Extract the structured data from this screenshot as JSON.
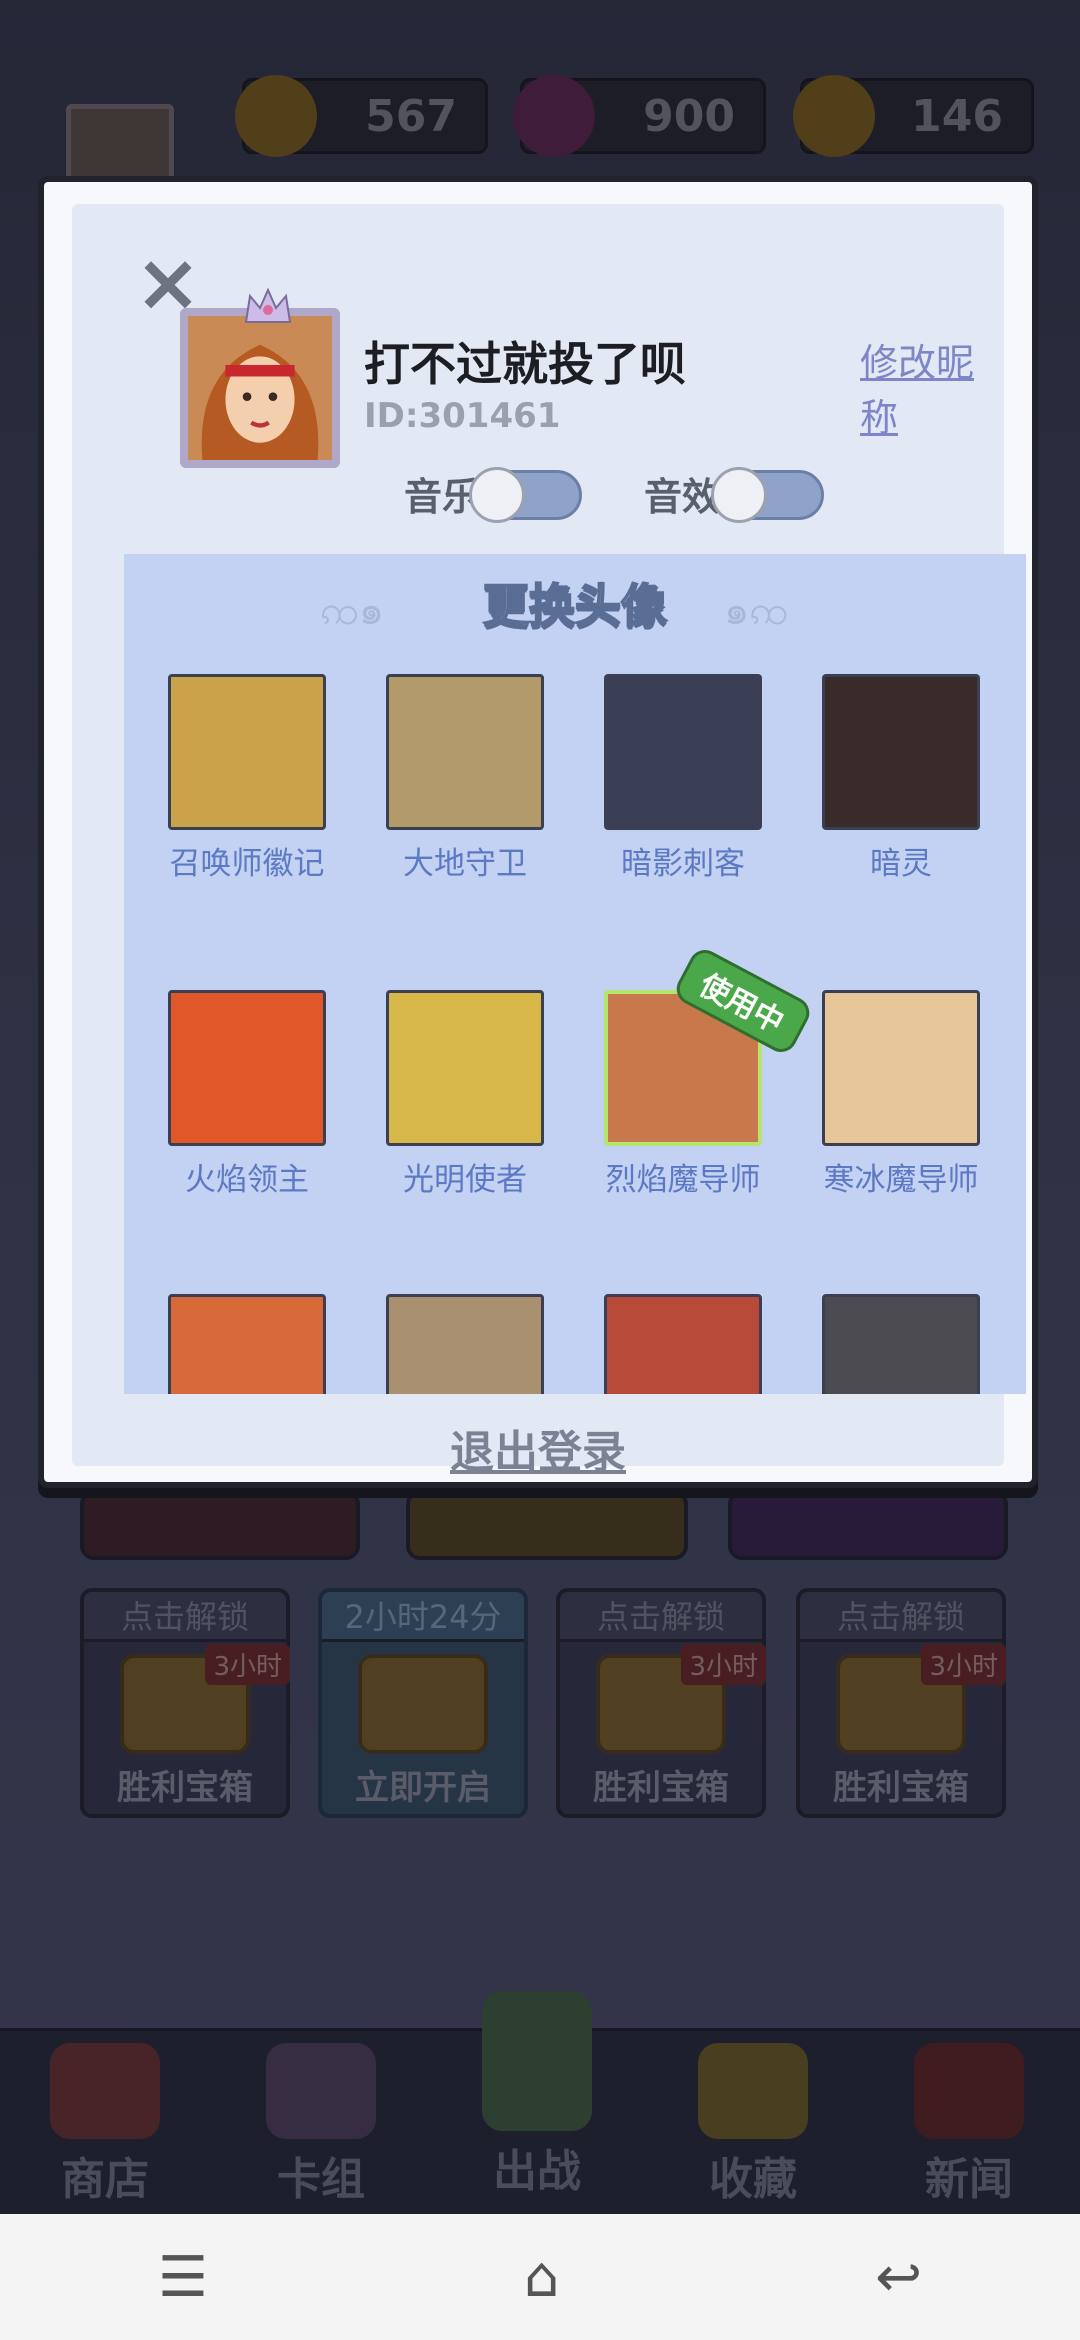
{
  "hud": {
    "gold": "567",
    "gems": "900",
    "stars": "146"
  },
  "profile": {
    "nickname": "打不过就投了呗",
    "id": "ID:301461",
    "rename_label": "修改昵称",
    "music_label": "音乐",
    "sfx_label": "音效",
    "music_on": false,
    "sfx_on": false
  },
  "avatar_panel": {
    "title": "更换头像",
    "in_use_badge": "使用中",
    "avatars": [
      {
        "name": "召唤师徽记",
        "color": "#c9a24a"
      },
      {
        "name": "大地守卫",
        "color": "#b29a6a"
      },
      {
        "name": "暗影刺客",
        "color": "#3b3f55"
      },
      {
        "name": "暗灵",
        "color": "#3a2b2b"
      },
      {
        "name": "火焰领主",
        "color": "#e0582a"
      },
      {
        "name": "光明使者",
        "color": "#d7b64a"
      },
      {
        "name": "烈焰魔导师",
        "color": "#c8784a",
        "selected": true
      },
      {
        "name": "寒冰魔导师",
        "color": "#e7c79a"
      }
    ]
  },
  "logout_label": "退出登录",
  "chests": [
    {
      "top": "点击解锁",
      "name": "胜利宝箱",
      "time": "3小时"
    },
    {
      "top": "2小时24分",
      "name": "立即开启",
      "time": ""
    },
    {
      "top": "点击解锁",
      "name": "胜利宝箱",
      "time": "3小时"
    },
    {
      "top": "点击解锁",
      "name": "胜利宝箱",
      "time": "3小时"
    }
  ],
  "nav": {
    "shop": "商店",
    "deck": "卡组",
    "battle": "出战",
    "collection": "收藏",
    "news": "新闻"
  }
}
